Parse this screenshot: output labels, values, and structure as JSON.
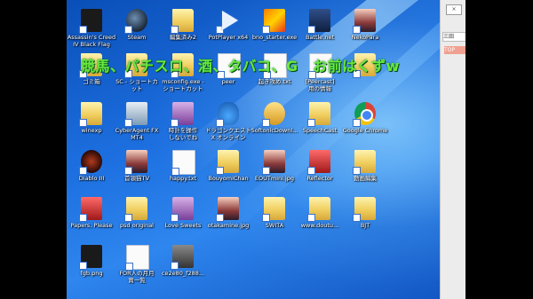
{
  "caption": "競馬、パチスロ、酒、タバコ、G　お前はくずw",
  "desktop_icons": [
    {
      "label": "Assassin's Creed\nIV Black Flag",
      "kind": "black"
    },
    {
      "label": "Steam",
      "kind": "steam"
    },
    {
      "label": "編集済み2",
      "kind": "folder"
    },
    {
      "label": "PotPlayer x64",
      "kind": "play"
    },
    {
      "label": "bno_starter.exe",
      "kind": "banner"
    },
    {
      "label": "Battle.net",
      "kind": "battle"
    },
    {
      "label": "NekoPara",
      "kind": "anime"
    },
    {
      "label": "ゴミ箱",
      "kind": "folder"
    },
    {
      "label": "SC - ショートカ\nット",
      "kind": "folder"
    },
    {
      "label": "msconfig.exe -\nショートカット",
      "kind": "folder"
    },
    {
      "label": "peer",
      "kind": "file"
    },
    {
      "label": "起き攻め.txt",
      "kind": "file"
    },
    {
      "label": "[Peercast]\n用の情報",
      "kind": "file"
    },
    {
      "label": "",
      "kind": "folder"
    },
    {
      "label": "winexp",
      "kind": "folder"
    },
    {
      "label": "CyberAgent FX\nMT4",
      "kind": "cyberagent"
    },
    {
      "label": "時計を操作\nしないでね",
      "kind": "purple"
    },
    {
      "label": "ドラゴンクエスト\nX オンライン",
      "kind": "slime"
    },
    {
      "label": "SoftonicDownl...",
      "kind": "gold"
    },
    {
      "label": "SpeechCast",
      "kind": "folder"
    },
    {
      "label": "Google Chrome",
      "kind": "chrome"
    },
    {
      "label": "Diablo III",
      "kind": "diablo"
    },
    {
      "label": "首領猫TV",
      "kind": "anime"
    },
    {
      "label": "happy.txt",
      "kind": "file"
    },
    {
      "label": "BouyomiChan",
      "kind": "folder"
    },
    {
      "label": "EOUTmini.jpg",
      "kind": "anime"
    },
    {
      "label": "Reflector",
      "kind": "red"
    },
    {
      "label": "動画編集",
      "kind": "folder"
    },
    {
      "label": "Papers, Please",
      "kind": "red"
    },
    {
      "label": "psd original",
      "kind": "folder"
    },
    {
      "label": "Love Sweets",
      "kind": "purple"
    },
    {
      "label": "otakamine.jpg",
      "kind": "anime"
    },
    {
      "label": "SWITA",
      "kind": "folder"
    },
    {
      "label": "www.doutu...",
      "kind": "folder"
    },
    {
      "label": "BJT",
      "kind": "folder"
    },
    {
      "label": "fgb.png",
      "kind": "black"
    },
    {
      "label": "FOR人の月月\n賞一覧",
      "kind": "file"
    },
    {
      "label": "ce2e80_f288...",
      "kind": "gray"
    }
  ],
  "panel": {
    "close": "×",
    "field": "三田",
    "tab": "TOP"
  }
}
